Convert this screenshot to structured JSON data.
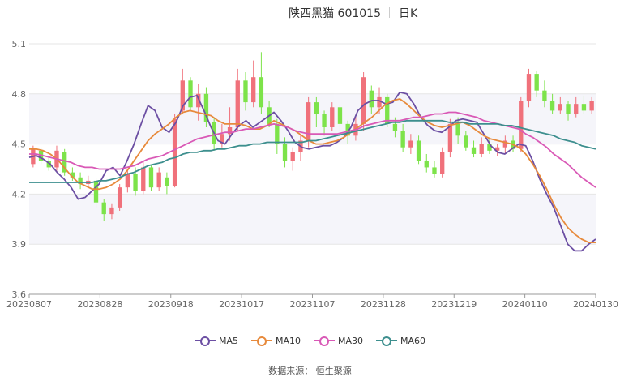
{
  "header": {
    "title": "陕西黑猫 601015",
    "period": "日K"
  },
  "source": "数据来源：  恒生聚源",
  "chart_data": {
    "type": "candlestick",
    "title": "陕西黑猫 601015",
    "period": "日K",
    "ylim": [
      3.6,
      5.1
    ],
    "yticks": [
      "5.1",
      "4.8",
      "4.5",
      "4.2",
      "3.9",
      "3.6"
    ],
    "xticks": [
      "20230807",
      "20230828",
      "20230918",
      "20231017",
      "20231107",
      "20231128",
      "20231219",
      "20240110",
      "20240130"
    ],
    "grid": true,
    "legend_position": "bottom",
    "colors": {
      "up": "#f0717b",
      "down": "#7de34a",
      "MA5": "#6c4fa3",
      "MA10": "#e78a3c",
      "MA30": "#d959b6",
      "MA60": "#3d8f8e"
    },
    "series": [
      {
        "name": "MA5",
        "values": [
          4.42,
          4.43,
          4.41,
          4.38,
          4.33,
          4.29,
          4.24,
          4.17,
          4.18,
          4.22,
          4.26,
          4.34,
          4.36,
          4.31,
          4.4,
          4.5,
          4.62,
          4.73,
          4.7,
          4.6,
          4.57,
          4.63,
          4.73,
          4.78,
          4.79,
          4.7,
          4.6,
          4.52,
          4.5,
          4.56,
          4.61,
          4.64,
          4.6,
          4.63,
          4.66,
          4.69,
          4.64,
          4.58,
          4.51,
          4.48,
          4.47,
          4.48,
          4.49,
          4.49,
          4.51,
          4.54,
          4.6,
          4.7,
          4.74,
          4.76,
          4.76,
          4.74,
          4.75,
          4.81,
          4.8,
          4.74,
          4.66,
          4.61,
          4.58,
          4.57,
          4.6,
          4.64,
          4.65,
          4.64,
          4.63,
          4.56,
          4.49,
          4.45,
          4.44,
          4.47,
          4.5,
          4.49,
          4.4,
          4.29,
          4.2,
          4.12,
          4.01,
          3.9,
          3.86,
          3.86,
          3.9,
          3.93
        ]
      },
      {
        "name": "MA10",
        "values": [
          4.47,
          4.47,
          4.46,
          4.44,
          4.41,
          4.36,
          4.31,
          4.27,
          4.25,
          4.23,
          4.23,
          4.24,
          4.26,
          4.29,
          4.34,
          4.4,
          4.46,
          4.52,
          4.56,
          4.59,
          4.62,
          4.66,
          4.69,
          4.7,
          4.69,
          4.68,
          4.67,
          4.64,
          4.62,
          4.62,
          4.62,
          4.61,
          4.59,
          4.59,
          4.61,
          4.64,
          4.62,
          4.6,
          4.58,
          4.55,
          4.52,
          4.5,
          4.5,
          4.51,
          4.52,
          4.54,
          4.57,
          4.6,
          4.63,
          4.66,
          4.7,
          4.74,
          4.76,
          4.77,
          4.74,
          4.7,
          4.66,
          4.63,
          4.61,
          4.6,
          4.61,
          4.62,
          4.63,
          4.61,
          4.58,
          4.55,
          4.53,
          4.52,
          4.51,
          4.5,
          4.48,
          4.44,
          4.38,
          4.31,
          4.23,
          4.14,
          4.06,
          4.0,
          3.96,
          3.93,
          3.91,
          3.91
        ]
      },
      {
        "name": "MA30",
        "values": [
          4.44,
          4.44,
          4.43,
          4.42,
          4.41,
          4.4,
          4.39,
          4.37,
          4.36,
          4.36,
          4.35,
          4.35,
          4.35,
          4.35,
          4.36,
          4.37,
          4.39,
          4.41,
          4.42,
          4.43,
          4.45,
          4.47,
          4.49,
          4.51,
          4.53,
          4.54,
          4.55,
          4.56,
          4.57,
          4.57,
          4.58,
          4.59,
          4.59,
          4.6,
          4.61,
          4.62,
          4.61,
          4.6,
          4.58,
          4.57,
          4.56,
          4.56,
          4.56,
          4.56,
          4.56,
          4.57,
          4.58,
          4.59,
          4.61,
          4.62,
          4.63,
          4.64,
          4.64,
          4.64,
          4.65,
          4.66,
          4.66,
          4.67,
          4.68,
          4.68,
          4.69,
          4.69,
          4.68,
          4.67,
          4.66,
          4.64,
          4.63,
          4.62,
          4.61,
          4.6,
          4.59,
          4.56,
          4.54,
          4.51,
          4.48,
          4.44,
          4.41,
          4.38,
          4.34,
          4.3,
          4.27,
          4.24
        ]
      },
      {
        "name": "MA60",
        "values": [
          4.27,
          4.27,
          4.27,
          4.27,
          4.27,
          4.27,
          4.27,
          4.27,
          4.27,
          4.27,
          4.28,
          4.28,
          4.29,
          4.3,
          4.32,
          4.33,
          4.35,
          4.37,
          4.38,
          4.39,
          4.41,
          4.42,
          4.44,
          4.45,
          4.45,
          4.46,
          4.46,
          4.47,
          4.47,
          4.48,
          4.49,
          4.49,
          4.5,
          4.5,
          4.51,
          4.51,
          4.51,
          4.51,
          4.51,
          4.51,
          4.52,
          4.52,
          4.53,
          4.54,
          4.55,
          4.56,
          4.57,
          4.58,
          4.59,
          4.6,
          4.61,
          4.62,
          4.63,
          4.63,
          4.64,
          4.64,
          4.64,
          4.64,
          4.64,
          4.64,
          4.63,
          4.63,
          4.63,
          4.62,
          4.62,
          4.62,
          4.62,
          4.62,
          4.61,
          4.61,
          4.6,
          4.59,
          4.58,
          4.57,
          4.56,
          4.55,
          4.53,
          4.52,
          4.51,
          4.49,
          4.48,
          4.47
        ]
      }
    ],
    "candles": [
      [
        4.38,
        4.47,
        4.36,
        4.49
      ],
      [
        4.46,
        4.4,
        4.38,
        4.48
      ],
      [
        4.4,
        4.36,
        4.34,
        4.43
      ],
      [
        4.36,
        4.46,
        4.34,
        4.49
      ],
      [
        4.45,
        4.33,
        4.31,
        4.47
      ],
      [
        4.33,
        4.3,
        4.28,
        4.36
      ],
      [
        4.3,
        4.26,
        4.23,
        4.33
      ],
      [
        4.26,
        4.28,
        4.24,
        4.31
      ],
      [
        4.28,
        4.15,
        4.12,
        4.3
      ],
      [
        4.15,
        4.08,
        4.04,
        4.17
      ],
      [
        4.08,
        4.12,
        4.05,
        4.14
      ],
      [
        4.12,
        4.24,
        4.1,
        4.26
      ],
      [
        4.24,
        4.32,
        4.21,
        4.35
      ],
      [
        4.32,
        4.22,
        4.19,
        4.36
      ],
      [
        4.22,
        4.36,
        4.2,
        4.4
      ],
      [
        4.36,
        4.24,
        4.22,
        4.37
      ],
      [
        4.24,
        4.33,
        4.22,
        4.36
      ],
      [
        4.3,
        4.25,
        4.2,
        4.33
      ],
      [
        4.25,
        4.65,
        4.24,
        4.68
      ],
      [
        4.7,
        4.88,
        4.68,
        4.95
      ],
      [
        4.88,
        4.72,
        4.7,
        4.9
      ],
      [
        4.72,
        4.8,
        4.64,
        4.86
      ],
      [
        4.8,
        4.63,
        4.6,
        4.84
      ],
      [
        4.63,
        4.5,
        4.46,
        4.66
      ],
      [
        4.5,
        4.56,
        4.48,
        4.62
      ],
      [
        4.56,
        4.6,
        4.52,
        4.72
      ],
      [
        4.6,
        4.88,
        4.58,
        4.95
      ],
      [
        4.88,
        4.75,
        4.7,
        4.93
      ],
      [
        4.75,
        4.9,
        4.72,
        5.0
      ],
      [
        4.9,
        4.72,
        4.68,
        5.05
      ],
      [
        4.72,
        4.62,
        4.6,
        4.76
      ],
      [
        4.62,
        4.5,
        4.44,
        4.65
      ],
      [
        4.5,
        4.4,
        4.36,
        4.54
      ],
      [
        4.4,
        4.45,
        4.34,
        4.48
      ],
      [
        4.45,
        4.52,
        4.4,
        4.56
      ],
      [
        4.52,
        4.75,
        4.48,
        4.78
      ],
      [
        4.75,
        4.68,
        4.6,
        4.78
      ],
      [
        4.68,
        4.6,
        4.55,
        4.7
      ],
      [
        4.6,
        4.72,
        4.58,
        4.75
      ],
      [
        4.72,
        4.62,
        4.58,
        4.74
      ],
      [
        4.62,
        4.55,
        4.5,
        4.64
      ],
      [
        4.55,
        4.62,
        4.52,
        4.67
      ],
      [
        4.62,
        4.9,
        4.58,
        4.93
      ],
      [
        4.82,
        4.72,
        4.68,
        4.85
      ],
      [
        4.72,
        4.78,
        4.68,
        4.84
      ],
      [
        4.78,
        4.62,
        4.6,
        4.8
      ],
      [
        4.62,
        4.58,
        4.54,
        4.66
      ],
      [
        4.58,
        4.48,
        4.45,
        4.62
      ],
      [
        4.48,
        4.52,
        4.44,
        4.56
      ],
      [
        4.52,
        4.4,
        4.38,
        4.55
      ],
      [
        4.4,
        4.36,
        4.33,
        4.44
      ],
      [
        4.36,
        4.32,
        4.3,
        4.4
      ],
      [
        4.32,
        4.45,
        4.3,
        4.48
      ],
      [
        4.45,
        4.62,
        4.42,
        4.65
      ],
      [
        4.62,
        4.55,
        4.5,
        4.66
      ],
      [
        4.55,
        4.48,
        4.46,
        4.58
      ],
      [
        4.48,
        4.44,
        4.42,
        4.52
      ],
      [
        4.44,
        4.5,
        4.42,
        4.54
      ],
      [
        4.5,
        4.46,
        4.44,
        4.53
      ],
      [
        4.46,
        4.48,
        4.43,
        4.5
      ],
      [
        4.48,
        4.52,
        4.44,
        4.55
      ],
      [
        4.52,
        4.47,
        4.45,
        4.55
      ],
      [
        4.47,
        4.76,
        4.45,
        4.78
      ],
      [
        4.76,
        4.92,
        4.72,
        4.95
      ],
      [
        4.92,
        4.82,
        4.78,
        4.94
      ],
      [
        4.82,
        4.76,
        4.72,
        4.88
      ],
      [
        4.76,
        4.7,
        4.68,
        4.8
      ],
      [
        4.7,
        4.74,
        4.68,
        4.78
      ],
      [
        4.74,
        4.68,
        4.64,
        4.76
      ],
      [
        4.68,
        4.74,
        4.66,
        4.78
      ],
      [
        4.74,
        4.7,
        4.68,
        4.79
      ],
      [
        4.7,
        4.76,
        4.68,
        4.78
      ]
    ]
  }
}
